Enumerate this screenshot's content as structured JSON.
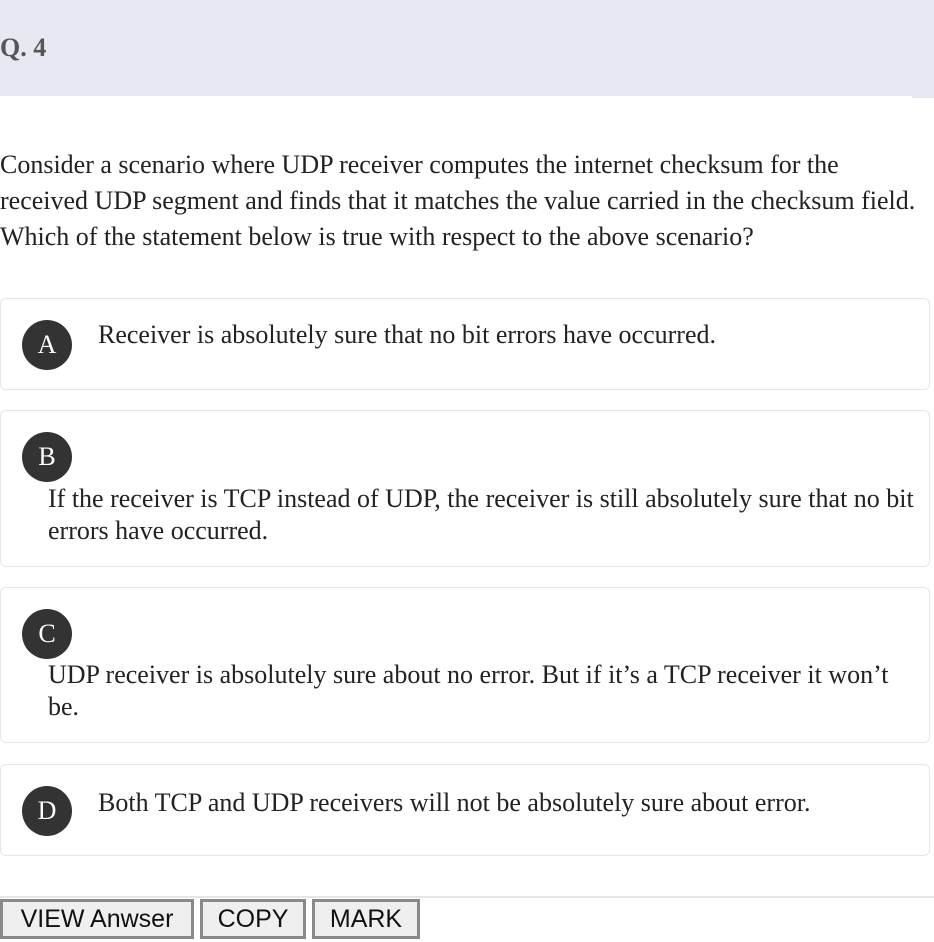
{
  "question": {
    "number": "Q. 4",
    "text": "Consider a scenario where UDP receiver computes the internet checksum for the received UDP segment and finds that it matches the value carried in the checksum field. Which of the statement below is true with respect to the above scenario?"
  },
  "options": [
    {
      "letter": "A",
      "text": "Receiver is absolutely sure that no bit errors have occurred."
    },
    {
      "letter": "B",
      "text": "If the receiver is TCP instead of UDP, the receiver is still absolutely sure that no bit errors have occurred."
    },
    {
      "letter": "C",
      "text": "UDP receiver is absolutely sure about no error. But if it’s a TCP receiver it won’t be."
    },
    {
      "letter": "D",
      "text": "Both TCP and UDP receivers will not be absolutely sure about error."
    }
  ],
  "actions": {
    "view_answer": "VIEW Anwser",
    "copy": "COPY",
    "mark": "MARK"
  },
  "colors": {
    "header_bg": "#e6e9f2",
    "badge_bg": "#333333"
  }
}
